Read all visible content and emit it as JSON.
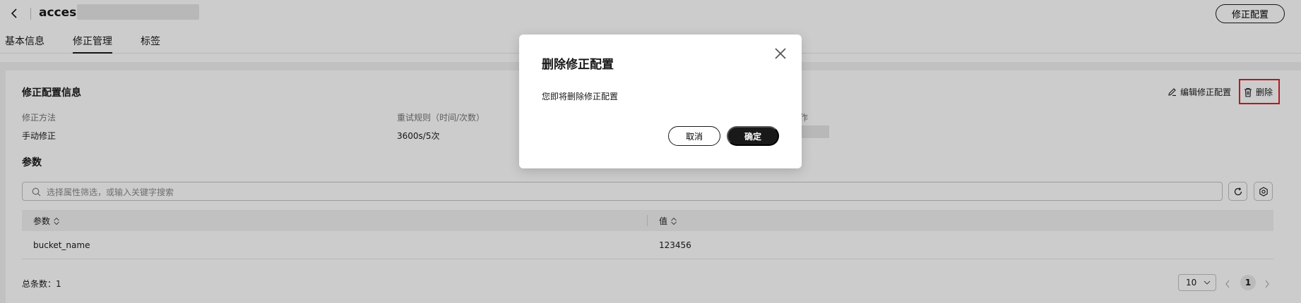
{
  "header": {
    "title": "access",
    "edit_button": "修正配置"
  },
  "tabs": [
    {
      "label": "基本信息",
      "active": false
    },
    {
      "label": "修正管理",
      "active": true
    },
    {
      "label": "标签",
      "active": false
    }
  ],
  "config_info": {
    "section_title": "修正配置信息",
    "edit_link": "编辑修正配置",
    "delete_link": "删除",
    "fields": [
      {
        "label": "修正方法",
        "value": "手动修正"
      },
      {
        "label": "重试规则（时间/次数）",
        "value": "3600s/5次"
      },
      {
        "label": "作",
        "value": ""
      }
    ]
  },
  "params": {
    "section_title": "参数",
    "search_placeholder": "选择属性筛选，或输入关键字搜索",
    "columns": [
      "参数",
      "值"
    ],
    "rows": [
      {
        "name": "bucket_name",
        "value": "123456"
      }
    ],
    "total": "总条数：1",
    "page_size": "10",
    "current_page": "1"
  },
  "dialog": {
    "title": "删除修正配置",
    "message": "您即将删除修正配置",
    "cancel": "取消",
    "confirm": "确定"
  },
  "colors": {
    "primary": "#191919",
    "highlight": "#e0202b"
  }
}
